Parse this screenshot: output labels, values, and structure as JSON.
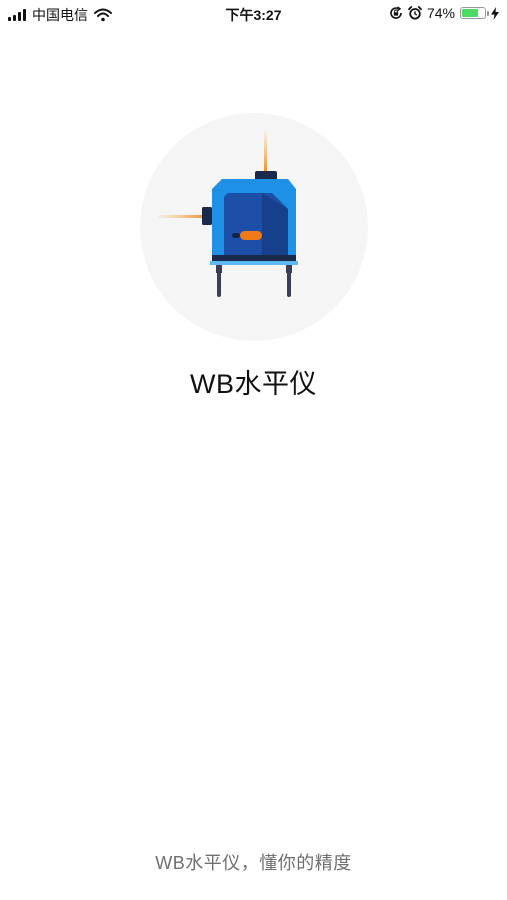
{
  "status_bar": {
    "carrier": "中国电信",
    "time": "下午3:27",
    "battery_percent_label": "74%",
    "battery_level": 0.74,
    "icons": [
      "signal-icon",
      "wifi-icon",
      "lock-rotation-icon",
      "alarm-icon",
      "battery-icon",
      "charging-icon"
    ]
  },
  "splash": {
    "app_name": "WB水平仪",
    "slogan": "WB水平仪，懂你的精度",
    "logo_icon": "laser-level-icon"
  },
  "colors": {
    "background": "#ffffff",
    "logo_circle": "#f5f5f5",
    "device_blue": "#1e90e6",
    "device_dark_blue": "#1c4fa8",
    "laser_orange": "#f08a24",
    "slogan_gray": "#707070",
    "battery_green": "#4cd964"
  }
}
